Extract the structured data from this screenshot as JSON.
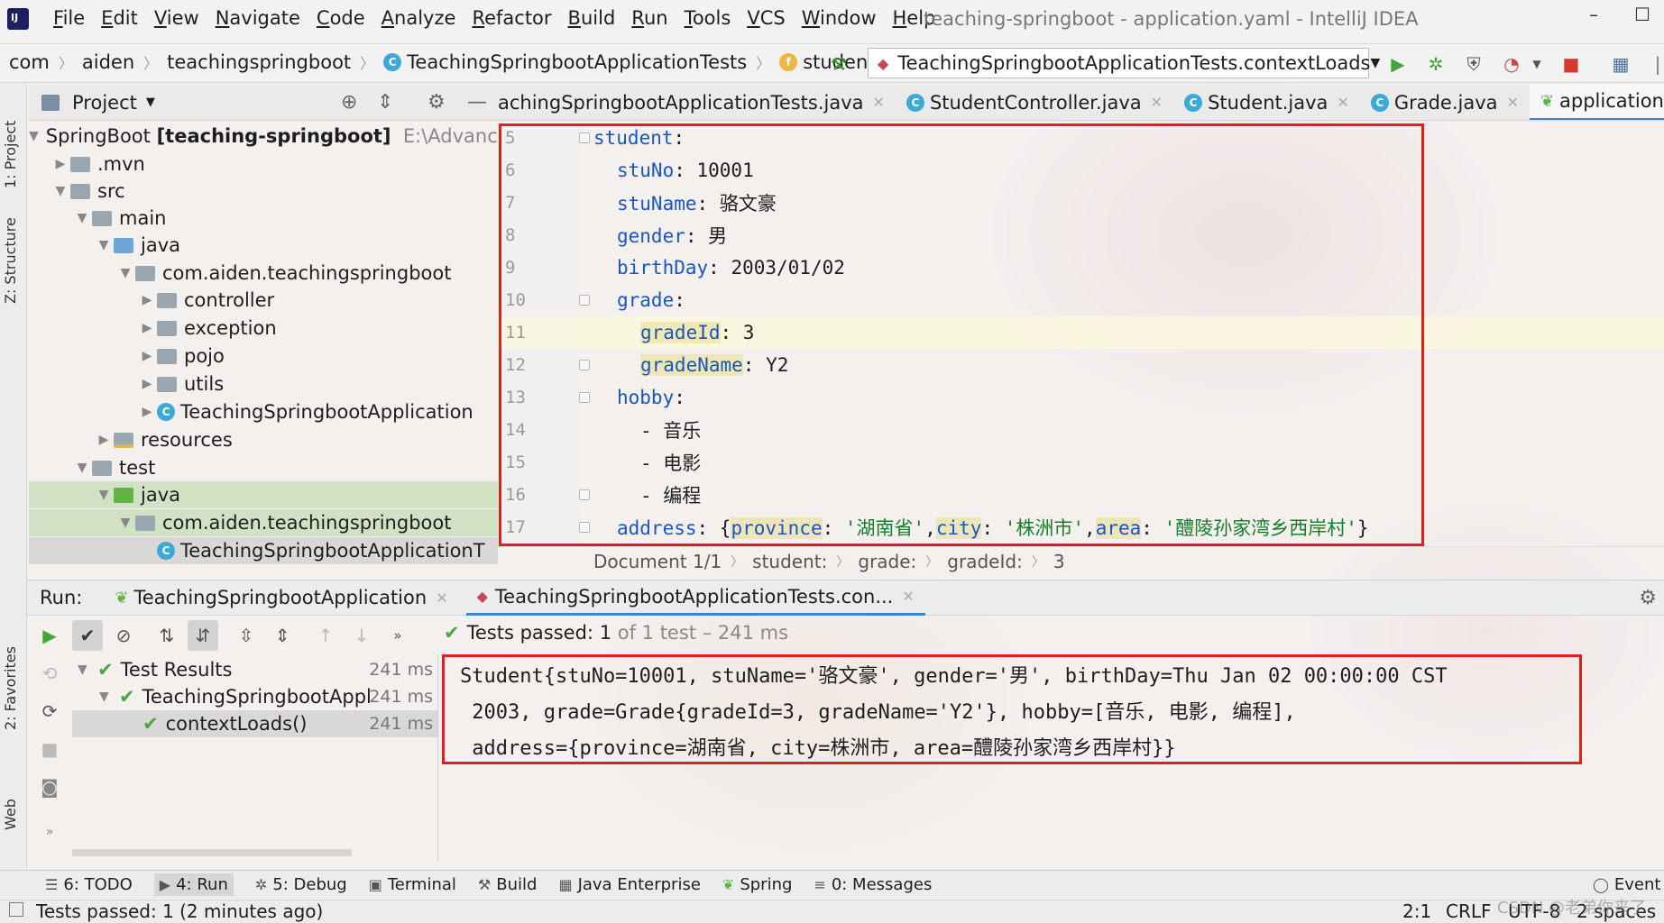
{
  "menu": {
    "items": [
      "File",
      "Edit",
      "View",
      "Navigate",
      "Code",
      "Analyze",
      "Refactor",
      "Build",
      "Run",
      "Tools",
      "VCS",
      "Window",
      "Help"
    ],
    "window_title": "teaching-springboot - application.yaml - IntelliJ IDEA"
  },
  "navbar": {
    "crumbs": [
      "com",
      "aiden",
      "teachingspringboot",
      "TeachingSpringbootApplicationTests",
      "student"
    ],
    "run_config": "TeachingSpringbootApplicationTests.contextLoads"
  },
  "left_stripe": {
    "project": "1: Project",
    "structure": "Z: Structure",
    "favorites": "2: Favorites",
    "web": "Web"
  },
  "project_panel": {
    "title": "Project",
    "tree": [
      {
        "label": "SpringBoot",
        "bold": "[teaching-springboot]",
        "path": "E:\\Advance"
      },
      {
        "label": ".mvn"
      },
      {
        "label": "src"
      },
      {
        "label": "main"
      },
      {
        "label": "java"
      },
      {
        "label": "com.aiden.teachingspringboot"
      },
      {
        "label": "controller"
      },
      {
        "label": "exception"
      },
      {
        "label": "pojo"
      },
      {
        "label": "utils"
      },
      {
        "label": "TeachingSpringbootApplication"
      },
      {
        "label": "resources"
      },
      {
        "label": "test"
      },
      {
        "label": "java"
      },
      {
        "label": "com.aiden.teachingspringboot"
      },
      {
        "label": "TeachingSpringbootApplicationT"
      }
    ]
  },
  "editor": {
    "tabs": [
      {
        "label": "achingSpringbootApplicationTests.java",
        "icon": "test-class-icon"
      },
      {
        "label": "StudentController.java",
        "icon": "class-icon"
      },
      {
        "label": "Student.java",
        "icon": "class-icon"
      },
      {
        "label": "Grade.java",
        "icon": "class-icon"
      },
      {
        "label": "application.yaml",
        "icon": "yaml-icon"
      }
    ],
    "line_numbers": [
      "5",
      "6",
      "7",
      "8",
      "9",
      "10",
      "11",
      "12",
      "13",
      "14",
      "15",
      "16",
      "17"
    ],
    "code": {
      "l5_key": "student",
      "l5_rest": ":",
      "l6_key": "stuNo",
      "l6_rest": ": 10001",
      "l7_key": "stuName",
      "l7_rest": ": 骆文豪",
      "l8_key": "gender",
      "l8_rest": ": 男",
      "l9_key": "birthDay",
      "l9_rest": ": 2003/01/02",
      "l10_key": "grade",
      "l10_rest": ":",
      "l11_key": "gradeId",
      "l11_rest": ": 3",
      "l12_key": "gradeName",
      "l12_rest": ": Y2",
      "l13_key": "hobby",
      "l13_rest": ":",
      "l14": "- 音乐",
      "l15": "- 电影",
      "l16": "- 编程",
      "l17_key": "address",
      "l17_a": ": {",
      "l17_k1": "province",
      "l17_v1": "'湖南省'",
      "l17_k2": "city",
      "l17_v2": "'株洲市'",
      "l17_k3": "area",
      "l17_v3": "'醴陵孙家湾乡西岸村'",
      "l17_end": "}"
    },
    "breadcrumb": [
      "Document 1/1",
      "student:",
      "grade:",
      "gradeId:",
      "3"
    ]
  },
  "run": {
    "label": "Run:",
    "tabs": [
      {
        "label": "TeachingSpringbootApplication"
      },
      {
        "label": "TeachingSpringbootApplicationTests.con..."
      }
    ],
    "status_prefix": "Tests passed:",
    "status_count": "1",
    "status_suffix": "of 1 test – 241 ms",
    "tree": [
      {
        "label": "Test Results",
        "time": "241 ms"
      },
      {
        "label": "TeachingSpringbootAppl",
        "time": "241 ms"
      },
      {
        "label": "contextLoads()",
        "time": "241 ms"
      }
    ],
    "console": [
      "Student{stuNo=10001, stuName='骆文豪', gender='男', birthDay=Thu Jan 02 00:00:00 CST",
      " 2003, grade=Grade{gradeId=3, gradeName='Y2'}, hobby=[音乐, 电影, 编程],",
      " address={province=湖南省, city=株洲市, area=醴陵孙家湾乡西岸村}}"
    ]
  },
  "bottom_tools": [
    {
      "label": "6: TODO"
    },
    {
      "label": "4: Run"
    },
    {
      "label": "5: Debug"
    },
    {
      "label": "Terminal"
    },
    {
      "label": "Build"
    },
    {
      "label": "Java Enterprise"
    },
    {
      "label": "Spring"
    },
    {
      "label": "0: Messages"
    },
    {
      "label": "Event L"
    }
  ],
  "status_bar": {
    "message": "Tests passed: 1 (2 minutes ago)",
    "position": "2:1",
    "line_sep": "CRLF",
    "encoding": "UTF-8",
    "indent": "2 spaces",
    "watermark": "CSDN @老弟你来了"
  },
  "colors": {
    "accent": "#4083c9",
    "highlight_box": "#e02020",
    "yaml_key": "#1a55c4",
    "yaml_string": "#177d2c",
    "pass": "#4aa544"
  }
}
